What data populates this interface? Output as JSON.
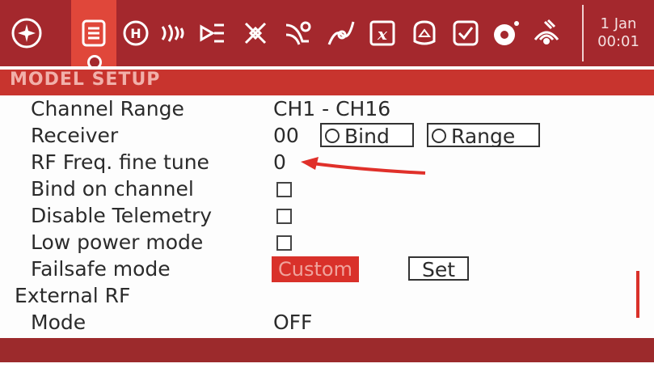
{
  "toolbar": {
    "icons": [
      "airplane-icon",
      "model-setup-icon",
      "heli-icon",
      "flight-modes-icon",
      "inputs-icon",
      "mixer-icon",
      "outputs-icon",
      "curves-icon",
      "logical-switches-icon",
      "global-vars-icon",
      "special-functions-icon",
      "checklist-icon",
      "telemetry-icon",
      "display-icon",
      "bell-icon"
    ],
    "date": "1 Jan",
    "time": "00:01"
  },
  "page": {
    "title": "MODEL SETUP"
  },
  "internal_rf": {
    "channel_range": {
      "label": "Channel Range",
      "value": "CH1 - CH16"
    },
    "receiver": {
      "label": "Receiver",
      "value": "00",
      "bind_label": "Bind",
      "range_label": "Range"
    },
    "rf_freq": {
      "label": "RF Freq. fine tune",
      "value": "0"
    },
    "bind_on_channel": {
      "label": "Bind on channel",
      "checked": false
    },
    "disable_telemetry": {
      "label": "Disable Telemetry",
      "checked": false
    },
    "low_power_mode": {
      "label": "Low power mode",
      "checked": false
    },
    "failsafe": {
      "label": "Failsafe mode",
      "value": "Custom",
      "set_label": "Set"
    }
  },
  "external_rf": {
    "title": "External RF",
    "mode": {
      "label": "Mode",
      "value": "OFF"
    }
  },
  "colors": {
    "toolbar": "#a4282d",
    "accent": "#d9312a",
    "annotation_arrow": "#e0302a"
  }
}
